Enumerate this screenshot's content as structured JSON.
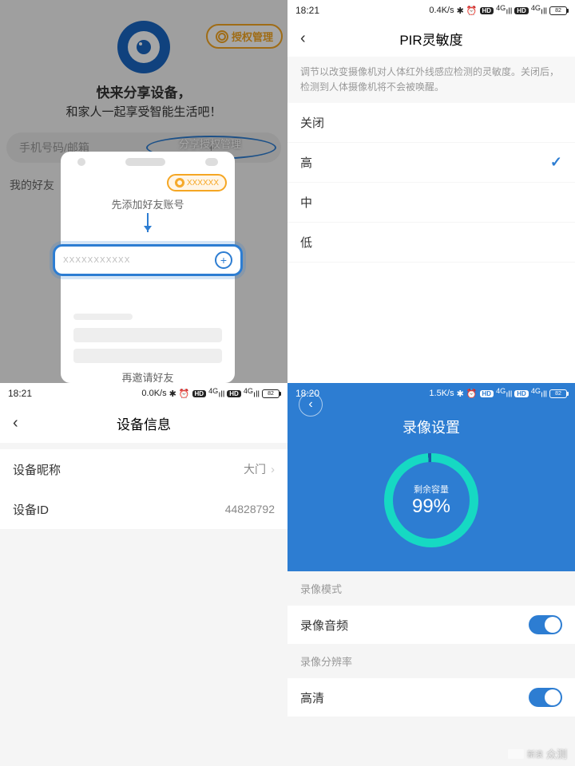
{
  "q1": {
    "auth_label": "授权管理",
    "title": "快来分享设备，",
    "subtitle": "和家人一起享受智能生活吧！",
    "placeholder": "手机号码/邮箱",
    "share_label": "分享授权管理",
    "friends_label": "我的好友",
    "tut_chip": "XXXXXX",
    "tut_step1": "先添加好友账号",
    "tut_input_ph": "XXXXXXXXXXX",
    "tut_step2": "再邀请好友"
  },
  "q2": {
    "status": {
      "time": "18:21",
      "speed": "0.4K/s",
      "battery": "82"
    },
    "title": "PIR灵敏度",
    "desc": "调节以改变摄像机对人体红外线感应检测的灵敏度。关闭后，检测到人体摄像机将不会被唤醒。",
    "items": [
      "关闭",
      "高",
      "中",
      "低"
    ],
    "selected_index": 1
  },
  "q3": {
    "status": {
      "time": "18:21",
      "speed": "0.0K/s",
      "battery": "82"
    },
    "title": "设备信息",
    "nickname_label": "设备昵称",
    "nickname_value": "大门",
    "id_label": "设备ID",
    "id_value": "44828792"
  },
  "q4": {
    "status": {
      "time": "18:20",
      "speed": "1.5K/s",
      "battery": "82"
    },
    "title": "录像设置",
    "ring_label": "剩余容量",
    "ring_value": "99%",
    "section_mode": "录像模式",
    "audio_label": "录像音频",
    "audio_on": true,
    "section_res": "录像分辨率",
    "hd_label": "高清",
    "hd_on": true
  },
  "watermark": "众测"
}
